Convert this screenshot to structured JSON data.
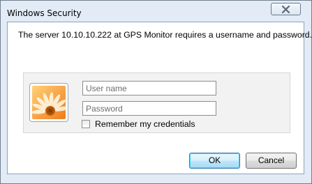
{
  "window": {
    "title": "Windows Security",
    "close_icon": "close-icon"
  },
  "message": "The server 10.10.10.222 at GPS Monitor requires a username and password.",
  "credentials": {
    "avatar_icon": "user-tile-flower-icon",
    "username_placeholder": "User name",
    "username_value": "",
    "password_placeholder": "Password",
    "password_value": "",
    "remember_label": "Remember my credentials",
    "remember_checked": false
  },
  "buttons": {
    "ok": "OK",
    "cancel": "Cancel"
  },
  "colors": {
    "frame": "#e2ebf6",
    "ok_border": "#3c7fb1",
    "panel": "#f2f2f2"
  }
}
